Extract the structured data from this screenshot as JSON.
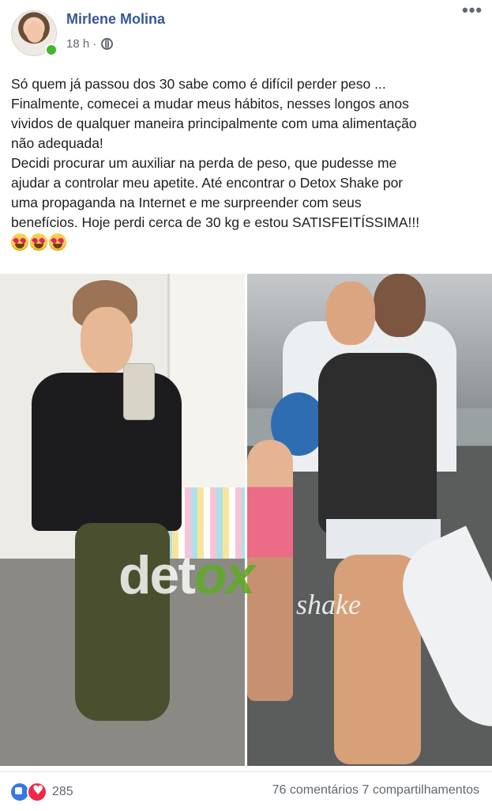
{
  "post": {
    "author_name": "Mirlene Molina",
    "time_ago": "18 h",
    "separator": "·",
    "privacy_icon": "globe-icon",
    "more_options_label": "•••",
    "text_lines": [
      "Só quem já passou dos 30 sabe como é difícil perder peso ...",
      "Finalmente, comecei a mudar meus hábitos, nesses longos anos",
      "vividos de qualquer maneira principalmente com uma alimentação",
      "não adequada!",
      "Decidi  procurar um auxiliar na perda de peso, que pudesse me",
      "ajudar a controlar meu apetite. Até encontrar o Detox Shake por",
      "uma propaganda na Internet e me surpreender com seus",
      "benefícios. Hoje perdi cerca de 30 kg e estou SATISFEITÍSSIMA!!!"
    ],
    "emojis": [
      "heart-eyes-emoji",
      "heart-eyes-emoji",
      "heart-eyes-emoji"
    ]
  },
  "images": {
    "watermark_main": "det",
    "watermark_x": "ox",
    "watermark_sub": "shake"
  },
  "footer": {
    "reaction_icons": [
      "like-icon",
      "love-icon"
    ],
    "reaction_count": "285",
    "comments_shares": "76 comentários 7 compartilhamentos"
  }
}
